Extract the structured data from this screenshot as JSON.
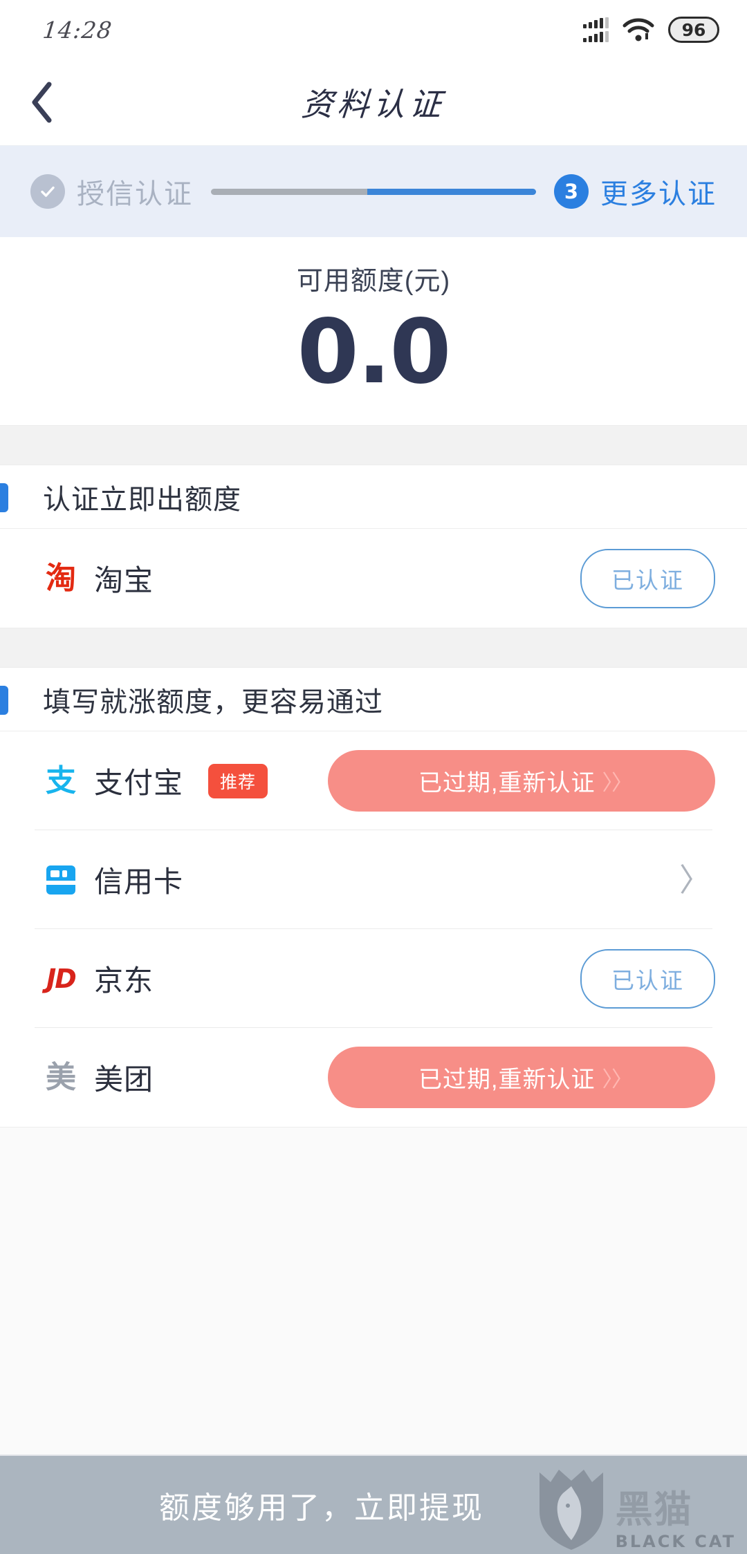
{
  "status_bar": {
    "time": "14:28",
    "battery_level": "96",
    "signal_icon": "signal-bars-icon",
    "wifi_icon": "wifi-icon"
  },
  "nav": {
    "back_icon": "back-chevron-icon",
    "title": "资料认证"
  },
  "steps": {
    "completed": {
      "icon": "check-icon",
      "label": "授信认证"
    },
    "current": {
      "number": "3",
      "label": "更多认证"
    },
    "progress_percent": 48,
    "colors": {
      "active": "#2b7fe0",
      "done": "#b9c1d1",
      "track": "#a9aeb5"
    }
  },
  "credit": {
    "label": "可用额度(元)",
    "value": "0.0",
    "value_color": "#2f3754"
  },
  "sections": [
    {
      "title": "认证立即出额度",
      "rows": [
        {
          "icon_text": "淘",
          "icon_name": "taobao-icon",
          "icon_class": "taobao",
          "name": "淘宝",
          "badge": null,
          "action_type": "verified",
          "action_label": "已认证"
        }
      ]
    },
    {
      "title": "填写就涨额度，更容易通过",
      "rows": [
        {
          "icon_text": "支",
          "icon_name": "alipay-icon",
          "icon_class": "alipay",
          "name": "支付宝",
          "badge": "推荐",
          "action_type": "expired",
          "action_label": "已过期,重新认证",
          "action_chevrons": "〉〉"
        },
        {
          "icon_text": "",
          "icon_name": "credit-card-icon",
          "icon_class": "card",
          "name": "信用卡",
          "badge": null,
          "action_type": "chevron",
          "action_label": "〉"
        },
        {
          "icon_text": "JD",
          "icon_name": "jd-icon",
          "icon_class": "jd",
          "name": "京东",
          "badge": null,
          "action_type": "verified",
          "action_label": "已认证"
        },
        {
          "icon_text": "美",
          "icon_name": "meituan-icon",
          "icon_class": "meituan",
          "name": "美团",
          "badge": null,
          "action_type": "expired",
          "action_label": "已过期,重新认证",
          "action_chevrons": "〉〉"
        }
      ]
    }
  ],
  "bottom_bar": {
    "text": "额度够用了，立即提现",
    "watermark_cn": "黑猫",
    "watermark_en": "BLACK CAT"
  }
}
